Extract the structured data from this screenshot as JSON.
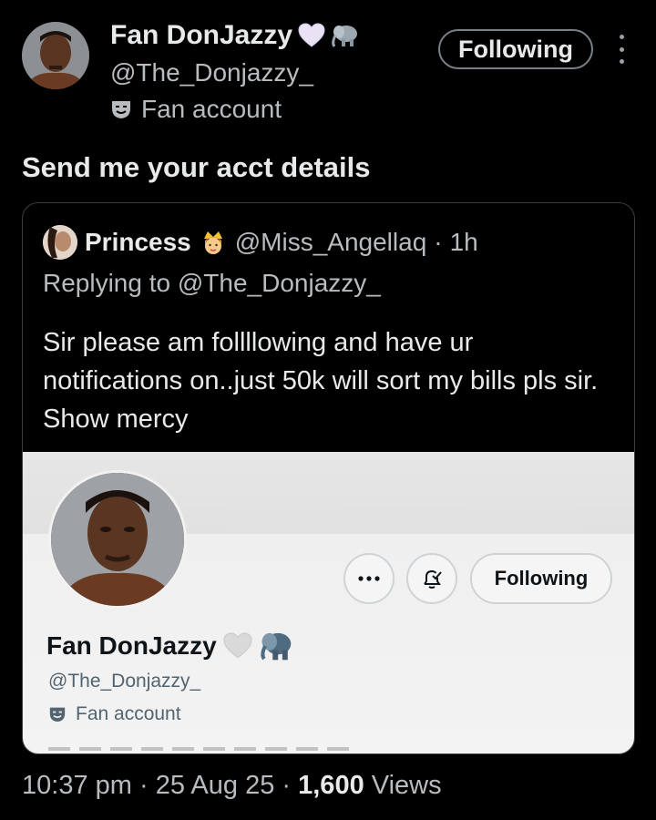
{
  "header": {
    "display_name": "Fan DonJazzy",
    "handle": "@The_Donjazzy_",
    "account_label": "Fan account",
    "follow_label": "Following"
  },
  "tweet": {
    "text": "Send me your acct details"
  },
  "quoted": {
    "name": "Princess",
    "handle": "@Miss_Angellaq",
    "dot": "·",
    "time": "1h",
    "replying_to": "Replying to @The_Donjazzy_",
    "body": "Sir please am follllowing and have ur notifications on..just 50k will sort my bills pls sir.  Show mercy"
  },
  "embedded_profile": {
    "display_name": "Fan DonJazzy",
    "handle": "@The_Donjazzy_",
    "account_label": "Fan account",
    "follow_label": "Following"
  },
  "footer": {
    "time": "10:37 pm",
    "sep1": " · ",
    "date": "25 Aug 25",
    "sep2": " · ",
    "views": "1,600",
    "views_label": "Views"
  },
  "colors": {
    "background": "#000000",
    "text_primary": "#e7e9ea",
    "text_secondary": "#b8bcbf"
  },
  "icons": [
    "white-heart-icon",
    "elephant-icon",
    "theater-mask-icon",
    "crown-emoji-icon",
    "more-icon",
    "notification-bell-icon"
  ]
}
